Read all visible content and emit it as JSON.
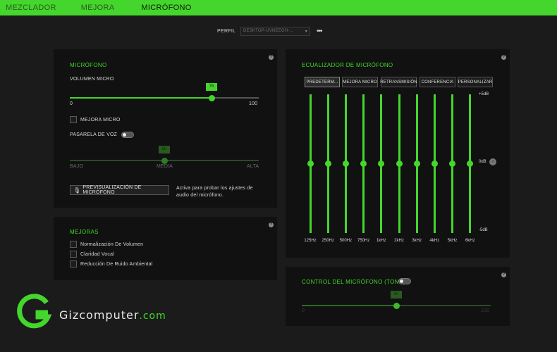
{
  "tabs": [
    {
      "label": "MEZCLADOR"
    },
    {
      "label": "MEJORA"
    },
    {
      "label": "MICRÓFONO"
    }
  ],
  "profile": {
    "label": "PERFIL",
    "value": "DESKTOP-UVNEEOH-...",
    "more": "•••"
  },
  "mic": {
    "title": "MICRÓFONO",
    "volume_label": "VOLUMEN MICRO",
    "volume_value": 75,
    "volume_display": "75",
    "volume_min": "0",
    "volume_max": "100",
    "enhance_label": "MEJORA MICRO",
    "gate_label": "PASARELA DE VOZ",
    "gate_value": 50,
    "gate_display": "50",
    "gate_low": "BAJO",
    "gate_mid": "MEDIA",
    "gate_high": "ALTA",
    "preview_button": "PREVISUALIZACIÓN DE MICRÓFONO",
    "preview_note": "Activa para probar los ajustes de audio del micrófono."
  },
  "improvements": {
    "title": "MEJORAS",
    "items": [
      {
        "label": "Normalización De Volumen"
      },
      {
        "label": "Claridad Vocal"
      },
      {
        "label": "Reducción De Ruido Ambiental"
      }
    ]
  },
  "eq": {
    "title": "ECUALIZADOR DE MICRÓFONO",
    "presets": [
      {
        "label": "PREDETERM..."
      },
      {
        "label": "MEJORA MICRO"
      },
      {
        "label": "RETRANSMISIÓN"
      },
      {
        "label": "CONFERENCIA"
      },
      {
        "label": "PERSONALIZAR"
      }
    ],
    "db_top": "+5dB",
    "db_mid": "0dB",
    "db_bottom": "-5dB",
    "bands": [
      {
        "freq": "125Hz",
        "gain": 0
      },
      {
        "freq": "250Hz",
        "gain": 0
      },
      {
        "freq": "500Hz",
        "gain": 0
      },
      {
        "freq": "750Hz",
        "gain": 0
      },
      {
        "freq": "1kHz",
        "gain": 0
      },
      {
        "freq": "2kHz",
        "gain": 0
      },
      {
        "freq": "3kHz",
        "gain": 0
      },
      {
        "freq": "4kHz",
        "gain": 0
      },
      {
        "freq": "5kHz",
        "gain": 0
      },
      {
        "freq": "6kHz",
        "gain": 0
      }
    ]
  },
  "sidetone": {
    "title": "CONTROL DEL MICRÓFONO (TONO)",
    "value": 50,
    "value_display": "50",
    "min": "0",
    "max": "100"
  },
  "watermark": {
    "brand": "Gizcomputer",
    "domain": ".com"
  },
  "colors": {
    "accent": "#44d62c",
    "background": "#1b1b1b",
    "panel": "#111111"
  }
}
